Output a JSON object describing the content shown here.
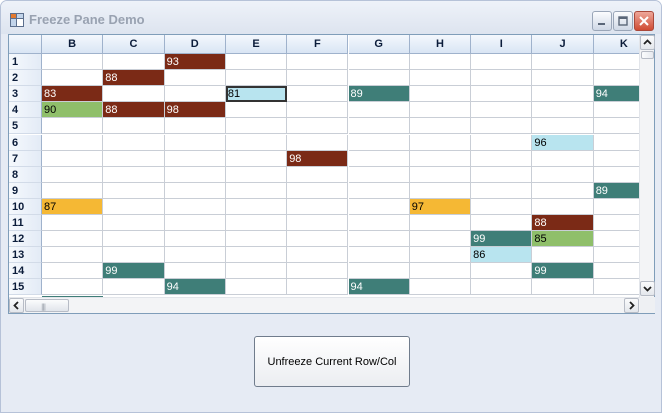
{
  "window": {
    "title": "Freeze Pane Demo",
    "controls": {
      "minimize_icon": "minimize-icon",
      "maximize_icon": "maximize-icon",
      "close_icon": "close-icon"
    }
  },
  "grid": {
    "columns": [
      "B",
      "C",
      "D",
      "E",
      "F",
      "G",
      "H",
      "I",
      "J",
      "K"
    ],
    "rows": [
      "1",
      "2",
      "3",
      "4",
      "5",
      "6",
      "7",
      "8",
      "9",
      "10",
      "11",
      "12",
      "13",
      "14",
      "15"
    ],
    "cells": [
      {
        "row": "1",
        "col": "D",
        "value": "93",
        "color": "#7b2a16"
      },
      {
        "row": "2",
        "col": "C",
        "value": "88",
        "color": "#7b2a16"
      },
      {
        "row": "3",
        "col": "B",
        "value": "83",
        "color": "#7b2a16"
      },
      {
        "row": "3",
        "col": "E",
        "value": "81",
        "color": "#b8e4ef",
        "selected": true
      },
      {
        "row": "3",
        "col": "G",
        "value": "89",
        "color": "#3f7e78"
      },
      {
        "row": "3",
        "col": "K",
        "value": "94",
        "color": "#3f7e78"
      },
      {
        "row": "4",
        "col": "B",
        "value": "90",
        "color": "#8fbf6a"
      },
      {
        "row": "4",
        "col": "C",
        "value": "88",
        "color": "#7b2a16"
      },
      {
        "row": "4",
        "col": "D",
        "value": "98",
        "color": "#7b2a16"
      },
      {
        "row": "6",
        "col": "J",
        "value": "96",
        "color": "#b8e4ef"
      },
      {
        "row": "7",
        "col": "F",
        "value": "98",
        "color": "#7b2a16"
      },
      {
        "row": "9",
        "col": "K",
        "value": "89",
        "color": "#3f7e78"
      },
      {
        "row": "10",
        "col": "B",
        "value": "87",
        "color": "#f5b834"
      },
      {
        "row": "10",
        "col": "H",
        "value": "97",
        "color": "#f5b834"
      },
      {
        "row": "11",
        "col": "J",
        "value": "88",
        "color": "#7b2a16"
      },
      {
        "row": "12",
        "col": "I",
        "value": "99",
        "color": "#3f7e78"
      },
      {
        "row": "12",
        "col": "J",
        "value": "85",
        "color": "#8fbf6a"
      },
      {
        "row": "13",
        "col": "I",
        "value": "86",
        "color": "#b8e4ef"
      },
      {
        "row": "14",
        "col": "C",
        "value": "99",
        "color": "#3f7e78"
      },
      {
        "row": "14",
        "col": "J",
        "value": "99",
        "color": "#3f7e78"
      },
      {
        "row": "15",
        "col": "D",
        "value": "94",
        "color": "#3f7e78"
      },
      {
        "row": "15",
        "col": "G",
        "value": "94",
        "color": "#3f7e78"
      }
    ],
    "partial_row_fill": {
      "col": "B",
      "color": "#3f7e78"
    }
  },
  "scrollbars": {
    "horizontal": {
      "left_icon": "arrow-left-icon",
      "right_icon": "arrow-right-icon"
    },
    "vertical": {
      "up_icon": "arrow-up-icon",
      "down_icon": "arrow-down-icon"
    }
  },
  "actions": {
    "unfreeze_label": "Unfreeze Current Row/Col"
  }
}
